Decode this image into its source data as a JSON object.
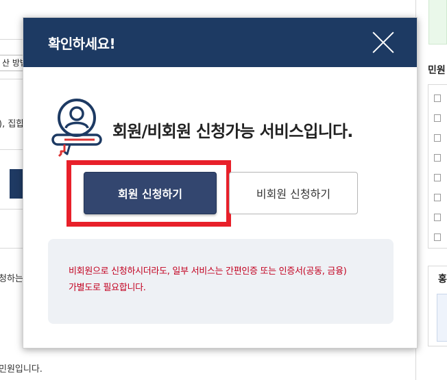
{
  "background": {
    "select_text": "산 방법",
    "snippet_1": "), 집합",
    "snippet_2": "청하는",
    "snippet_3": "민원입니다.",
    "sidebar_title": "민원",
    "sidebar_box_title": "홍"
  },
  "modal": {
    "title": "확인하세요!",
    "headline": "회원/비회원 신청가능 서비스입니다.",
    "member_button_label": "회원 신청하기",
    "guest_button_label": "비회원 신청하기",
    "notice_line_1": "비회원으로 신청하시더라도, 일부 서비스는 간편인증 또는 인증서(공동, 금융)",
    "notice_line_2": "가별도로 필요합니다."
  },
  "colors": {
    "header_bg": "#1d3a63",
    "member_button_bg": "#33466f",
    "highlight_border": "#e8202a",
    "notice_text": "#c2001f",
    "notice_bg": "#eef1f5"
  },
  "icons": [
    "close-icon",
    "member-service-icon",
    "document-icon"
  ]
}
